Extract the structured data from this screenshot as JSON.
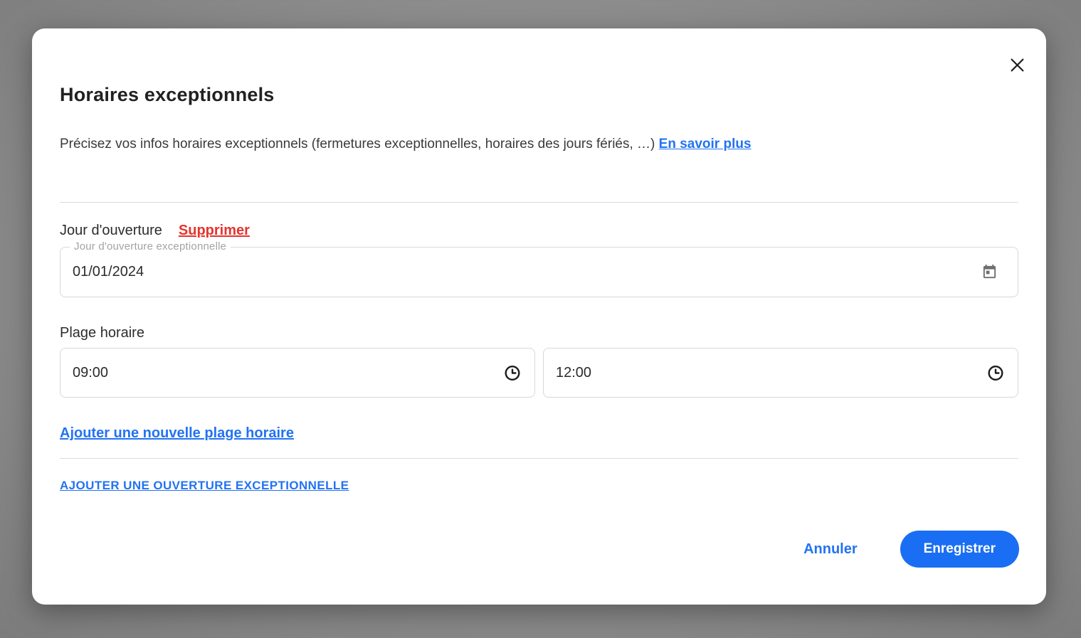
{
  "dialog": {
    "title": "Horaires exceptionnels",
    "description": "Précisez vos infos horaires exceptionnels (fermetures exceptionnelles, horaires des jours fériés, …) ",
    "learn_more_label": "En savoir plus"
  },
  "opening_day": {
    "section_label": "Jour d'ouverture",
    "delete_label": "Supprimer",
    "date_field": {
      "floating_label": "Jour d'ouverture exceptionnelle",
      "value": "01/01/2024",
      "icon": "calendar-icon"
    }
  },
  "time_range": {
    "section_label": "Plage horaire",
    "start": {
      "value": "09:00",
      "icon": "clock-icon"
    },
    "end": {
      "value": "12:00",
      "icon": "clock-icon"
    },
    "add_slot_label": "Ajouter une nouvelle plage horaire"
  },
  "add_opening_label": "AJOUTER UNE OUVERTURE EXCEPTIONNELLE",
  "footer": {
    "cancel_label": "Annuler",
    "save_label": "Enregistrer"
  },
  "colors": {
    "accent_blue": "#1a6ef3",
    "link_blue": "#2273f2",
    "danger_red": "#e5342e",
    "border_gray": "#d8d8d8",
    "backdrop_gray": "#8f8f8f"
  }
}
